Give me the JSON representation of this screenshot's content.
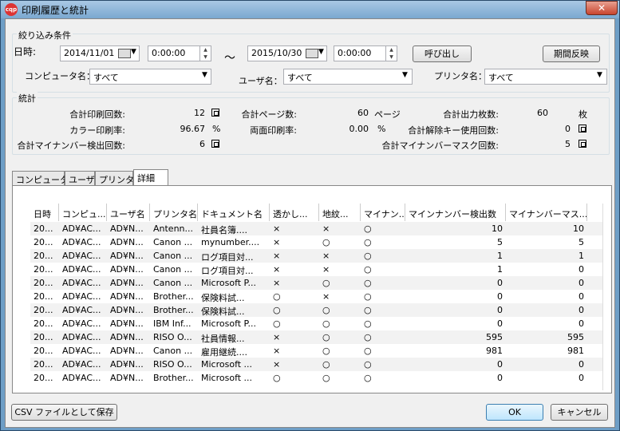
{
  "window": {
    "title": "印刷履歴と統計",
    "app_icon": "cqp",
    "close_glyph": "✕"
  },
  "filter": {
    "legend": "絞り込み条件",
    "date_label": "日時:",
    "date_from": "2014/11/01",
    "time_from": "0:00:00",
    "tilde": "～",
    "date_to": "2015/10/30",
    "time_to": "0:00:00",
    "recall_button": "呼び出し",
    "apply_period_button": "期間反映",
    "computer_label": "コンピュータ名：",
    "computer_value": "すべて",
    "user_label": "ユーザ名：",
    "user_value": "すべて",
    "printer_label": "プリンタ名：",
    "printer_value": "すべて"
  },
  "stats": {
    "legend": "統計",
    "total_print_label": "合計印刷回数:",
    "total_print_value": "12",
    "total_print_unit": "回",
    "total_pages_label": "合計ページ数:",
    "total_pages_value": "60",
    "total_pages_unit": "ページ",
    "total_sheets_label": "合計出力枚数:",
    "total_sheets_value": "60",
    "total_sheets_unit": "枚",
    "color_rate_label": "カラー印刷率:",
    "color_rate_value": "96.67",
    "color_rate_unit": "%",
    "duplex_rate_label": "両面印刷率:",
    "duplex_rate_value": "0.00",
    "duplex_rate_unit": "%",
    "unlock_key_label": "合計解除キー使用回数:",
    "unlock_key_value": "0",
    "unlock_key_unit": "回",
    "mynumber_detect_label": "合計マイナンバー検出回数:",
    "mynumber_detect_value": "6",
    "mynumber_detect_unit": "回",
    "mynumber_mask_label": "合計マイナンバーマスク回数:",
    "mynumber_mask_value": "5",
    "mynumber_mask_unit": "回"
  },
  "tabs": [
    "コンピュータ",
    "ユーザ",
    "プリンタ",
    "詳細"
  ],
  "table": {
    "headers": [
      "日時",
      "コンピュ...",
      "ユーザ名",
      "プリンタ名",
      "ドキュメント名",
      "透かし...",
      "地紋...",
      "マイナン...",
      "マインナンバー検出数",
      "マイナンバーマス..."
    ],
    "rows": [
      [
        "20...",
        "AD¥AC...",
        "AD¥N...",
        "Antenn...",
        "社員名簿....",
        "×",
        "×",
        "○",
        "10",
        "10"
      ],
      [
        "20...",
        "AD¥AC...",
        "AD¥N...",
        "Canon ...",
        "mynumber....",
        "×",
        "○",
        "○",
        "5",
        "5"
      ],
      [
        "20...",
        "AD¥AC...",
        "AD¥N...",
        "Canon ...",
        "ログ項目対...",
        "×",
        "×",
        "○",
        "1",
        "1"
      ],
      [
        "20...",
        "AD¥AC...",
        "AD¥N...",
        "Canon ...",
        "ログ項目対...",
        "×",
        "×",
        "○",
        "1",
        "0"
      ],
      [
        "20...",
        "AD¥AC...",
        "AD¥N...",
        "Canon ...",
        "Microsoft P...",
        "×",
        "○",
        "○",
        "0",
        "0"
      ],
      [
        "20...",
        "AD¥AC...",
        "AD¥N...",
        "Brother...",
        "保険料試...",
        "○",
        "×",
        "○",
        "0",
        "0"
      ],
      [
        "20...",
        "AD¥AC...",
        "AD¥N...",
        "Brother...",
        "保険料試...",
        "○",
        "○",
        "○",
        "0",
        "0"
      ],
      [
        "20...",
        "AD¥AC...",
        "AD¥N...",
        "IBM Inf...",
        "Microsoft P...",
        "○",
        "○",
        "○",
        "0",
        "0"
      ],
      [
        "20...",
        "AD¥AC...",
        "AD¥N...",
        "RISO O...",
        "社員情報...",
        "×",
        "○",
        "○",
        "595",
        "595"
      ],
      [
        "20...",
        "AD¥AC...",
        "AD¥N...",
        "Canon ...",
        "雇用継続....",
        "×",
        "○",
        "○",
        "981",
        "981"
      ],
      [
        "20...",
        "AD¥AC...",
        "AD¥N...",
        "RISO O...",
        "Microsoft ...",
        "×",
        "○",
        "○",
        "0",
        "0"
      ],
      [
        "20...",
        "AD¥AC...",
        "AD¥N...",
        "Brother...",
        "Microsoft ...",
        "○",
        "○",
        "○",
        "0",
        "0"
      ]
    ]
  },
  "footer": {
    "csv_button": "CSV ファイルとして保存",
    "ok_button": "OK",
    "cancel_button": "キャンセル"
  }
}
